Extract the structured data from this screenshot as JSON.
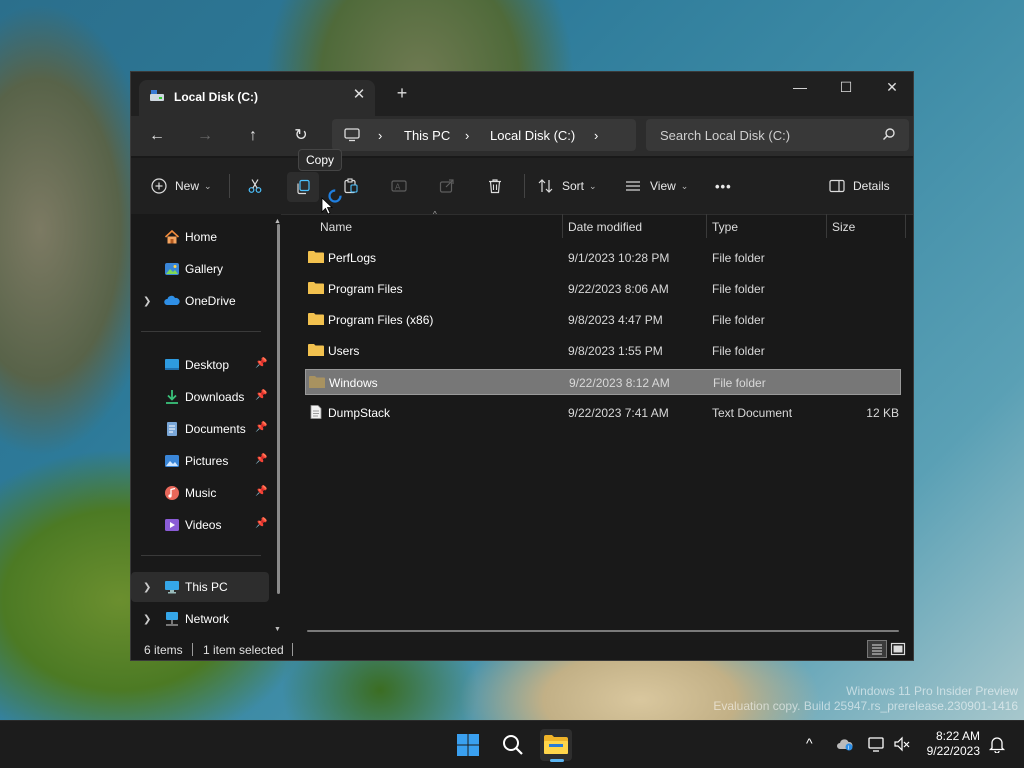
{
  "desktop": {
    "watermark_line1": "Windows 11 Pro Insider Preview",
    "watermark_line2": "Evaluation copy. Build 25947.rs_prerelease.230901-1416"
  },
  "window": {
    "tab_title": "Local Disk (C:)",
    "controls": {
      "minimize": "—",
      "maximize": "☐",
      "close": "✕"
    }
  },
  "address_bar": {
    "breadcrumb": [
      "This PC",
      "Local Disk (C:)"
    ],
    "separator": "›",
    "search_placeholder": "Search Local Disk (C:)"
  },
  "command_bar": {
    "new_label": "New",
    "sort_label": "Sort",
    "view_label": "View",
    "more_label": "•••",
    "details_label": "Details",
    "tooltip": "Copy"
  },
  "sidebar": {
    "items": [
      {
        "label": "Home",
        "icon": "home-icon",
        "expandable": false,
        "pinned": false
      },
      {
        "label": "Gallery",
        "icon": "gallery-icon",
        "expandable": false,
        "pinned": false
      },
      {
        "label": "OneDrive",
        "icon": "onedrive-icon",
        "expandable": true,
        "pinned": false
      },
      {
        "label": "Desktop",
        "icon": "desktop-icon",
        "expandable": false,
        "pinned": true
      },
      {
        "label": "Downloads",
        "icon": "downloads-icon",
        "expandable": false,
        "pinned": true
      },
      {
        "label": "Documents",
        "icon": "documents-icon",
        "expandable": false,
        "pinned": true
      },
      {
        "label": "Pictures",
        "icon": "pictures-icon",
        "expandable": false,
        "pinned": true
      },
      {
        "label": "Music",
        "icon": "music-icon",
        "expandable": false,
        "pinned": true
      },
      {
        "label": "Videos",
        "icon": "videos-icon",
        "expandable": false,
        "pinned": true
      },
      {
        "label": "This PC",
        "icon": "this-pc-icon",
        "expandable": true,
        "pinned": false,
        "selected": true
      },
      {
        "label": "Network",
        "icon": "network-icon",
        "expandable": true,
        "pinned": false
      }
    ]
  },
  "file_list": {
    "columns": [
      "Name",
      "Date modified",
      "Type",
      "Size"
    ],
    "rows": [
      {
        "name": "PerfLogs",
        "date": "9/1/2023 10:28 PM",
        "type": "File folder",
        "size": "",
        "icon": "folder-icon"
      },
      {
        "name": "Program Files",
        "date": "9/22/2023 8:06 AM",
        "type": "File folder",
        "size": "",
        "icon": "folder-icon"
      },
      {
        "name": "Program Files (x86)",
        "date": "9/8/2023 4:47 PM",
        "type": "File folder",
        "size": "",
        "icon": "folder-icon"
      },
      {
        "name": "Users",
        "date": "9/8/2023 1:55 PM",
        "type": "File folder",
        "size": "",
        "icon": "folder-icon"
      },
      {
        "name": "Windows",
        "date": "9/22/2023 8:12 AM",
        "type": "File folder",
        "size": "",
        "icon": "folder-icon",
        "selected": true
      },
      {
        "name": "DumpStack",
        "date": "9/22/2023 7:41 AM",
        "type": "Text Document",
        "size": "12 KB",
        "icon": "text-file-icon"
      }
    ]
  },
  "status_bar": {
    "item_count": "6 items",
    "selection": "1 item selected"
  },
  "taskbar": {
    "time": "8:22 AM",
    "date": "9/22/2023"
  },
  "colors": {
    "window_bg": "#191919",
    "selection": "#777777",
    "folder": "#f2c14e",
    "accent": "#4cc2ff"
  }
}
